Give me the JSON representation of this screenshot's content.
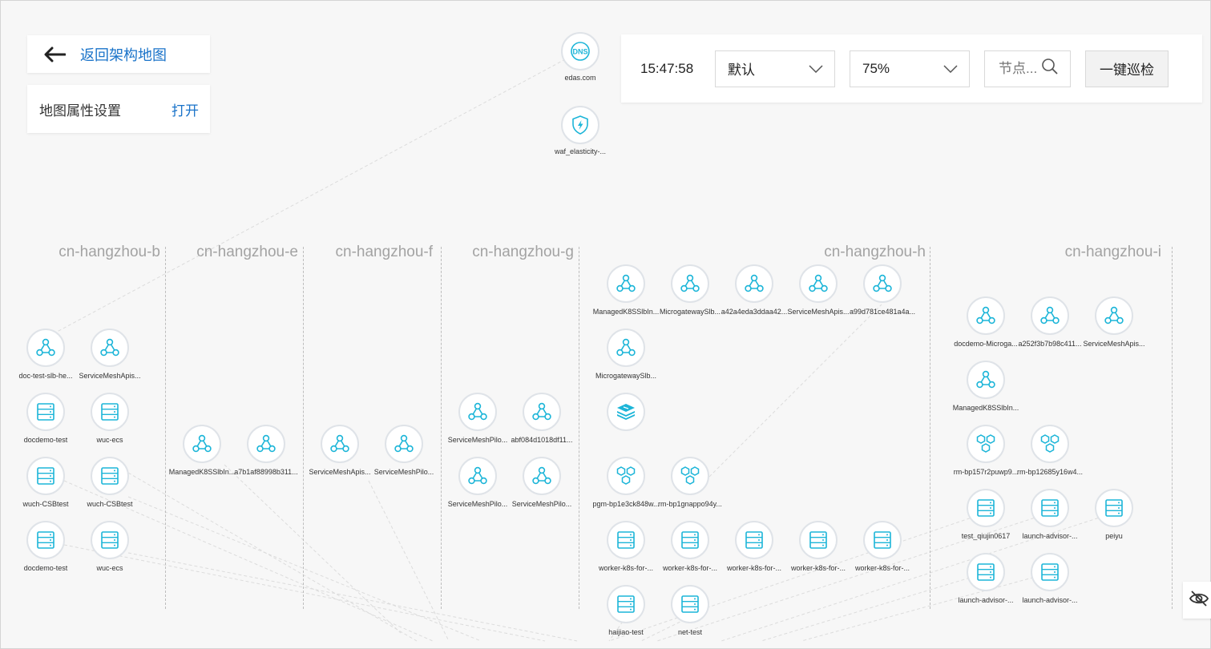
{
  "back": {
    "label": "返回架构地图"
  },
  "settings": {
    "label": "地图属性设置",
    "action": "打开"
  },
  "toolbar": {
    "time": "15:47:58",
    "view_select": "默认",
    "zoom_select": "75%",
    "search_placeholder": "节点...",
    "inspect_button": "一键巡检"
  },
  "colors": {
    "accent": "#1a73c9",
    "node_icon": "#1cb5d8",
    "zone_label": "#a3a3a3"
  },
  "external_nodes": [
    {
      "label": "edas.com",
      "icon": "dns-icon"
    },
    {
      "label": "waf_elasticity-...",
      "icon": "waf-shield-icon"
    }
  ],
  "zones": [
    {
      "label": "cn-hangzhou-b",
      "nodes": [
        {
          "label": "doc-test-slb-he...",
          "icon": "slb-icon"
        },
        {
          "label": "ServiceMeshApis...",
          "icon": "slb-icon"
        },
        {
          "label": "docdemo-test",
          "icon": "ecs-icon"
        },
        {
          "label": "wuc-ecs",
          "icon": "ecs-icon"
        },
        {
          "label": "wuch-CSBtest",
          "icon": "ecs-icon"
        },
        {
          "label": "wuch-CSBtest",
          "icon": "ecs-icon"
        },
        {
          "label": "docdemo-test",
          "icon": "ecs-icon"
        },
        {
          "label": "wuc-ecs",
          "icon": "ecs-icon"
        }
      ]
    },
    {
      "label": "cn-hangzhou-e",
      "nodes": [
        {
          "label": "ManagedK8SSlbIn...",
          "icon": "slb-icon"
        },
        {
          "label": "a7b1af88998b311...",
          "icon": "slb-icon"
        }
      ]
    },
    {
      "label": "cn-hangzhou-f",
      "nodes": [
        {
          "label": "ServiceMeshApis...",
          "icon": "slb-icon"
        },
        {
          "label": "ServiceMeshPilo...",
          "icon": "slb-icon"
        }
      ]
    },
    {
      "label": "cn-hangzhou-g",
      "nodes": [
        {
          "label": "ServiceMeshPilo...",
          "icon": "slb-icon"
        },
        {
          "label": "abf084d1018df11...",
          "icon": "slb-icon"
        },
        {
          "label": "ServiceMeshPilo...",
          "icon": "slb-icon"
        },
        {
          "label": "ServiceMeshPilo...",
          "icon": "slb-icon"
        }
      ]
    },
    {
      "label": "cn-hangzhou-h",
      "nodes": [
        {
          "label": "ManagedK8SSlbIn...",
          "icon": "slb-icon"
        },
        {
          "label": "MicrogatewaySlb...",
          "icon": "slb-icon"
        },
        {
          "label": "a42a4eda3ddaa42...",
          "icon": "slb-icon"
        },
        {
          "label": "ServiceMeshApis...",
          "icon": "slb-icon"
        },
        {
          "label": "a99d781ce481a4a...",
          "icon": "slb-icon"
        },
        {
          "label": "MicrogatewaySlb...",
          "icon": "slb-icon"
        },
        {
          "label": "",
          "icon": "redis-stack-icon"
        },
        {
          "label": "pgm-bp1e3ck848w...",
          "icon": "rds-hexagon-icon"
        },
        {
          "label": "rm-bp1gnappo94y...",
          "icon": "rds-hexagon-icon"
        },
        {
          "label": "worker-k8s-for-...",
          "icon": "ecs-icon"
        },
        {
          "label": "worker-k8s-for-...",
          "icon": "ecs-icon"
        },
        {
          "label": "worker-k8s-for-...",
          "icon": "ecs-icon"
        },
        {
          "label": "worker-k8s-for-...",
          "icon": "ecs-icon"
        },
        {
          "label": "worker-k8s-for-...",
          "icon": "ecs-icon"
        },
        {
          "label": "haijiao-test",
          "icon": "ecs-icon"
        },
        {
          "label": "net-test",
          "icon": "ecs-icon"
        }
      ]
    },
    {
      "label": "cn-hangzhou-i",
      "nodes": [
        {
          "label": "docdemo-Microga...",
          "icon": "slb-icon"
        },
        {
          "label": "a252f3b7b98c411...",
          "icon": "slb-icon"
        },
        {
          "label": "ServiceMeshApis...",
          "icon": "slb-icon"
        },
        {
          "label": "ManagedK8SSlbIn...",
          "icon": "slb-icon"
        },
        {
          "label": "rm-bp157r2puwp9...",
          "icon": "rds-hexagon-icon"
        },
        {
          "label": "rm-bp12685y16w4...",
          "icon": "rds-hexagon-icon"
        },
        {
          "label": "test_qiujin0617",
          "icon": "ecs-icon"
        },
        {
          "label": "launch-advisor-...",
          "icon": "ecs-icon"
        },
        {
          "label": "peiyu",
          "icon": "ecs-icon"
        },
        {
          "label": "launch-advisor-...",
          "icon": "ecs-icon"
        },
        {
          "label": "launch-advisor-...",
          "icon": "ecs-icon"
        }
      ]
    }
  ],
  "corner_toggle": {
    "icon": "eye-off-icon"
  }
}
